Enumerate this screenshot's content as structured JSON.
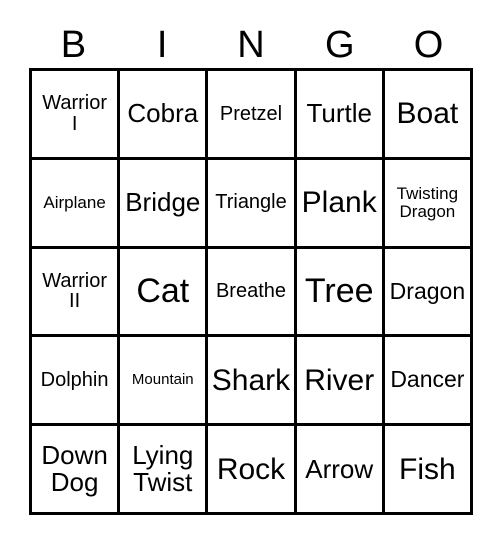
{
  "card": {
    "title_letters": [
      "B",
      "I",
      "N",
      "G",
      "O"
    ],
    "columns": [
      "B",
      "I",
      "N",
      "G",
      "O"
    ],
    "rows": [
      [
        {
          "label": "Warrior\nI",
          "size": "md"
        },
        {
          "label": "Cobra",
          "size": "xl"
        },
        {
          "label": "Pretzel",
          "size": "md"
        },
        {
          "label": "Turtle",
          "size": "xl"
        },
        {
          "label": "Boat",
          "size": "2xl"
        }
      ],
      [
        {
          "label": "Airplane",
          "size": "sm"
        },
        {
          "label": "Bridge",
          "size": "xl"
        },
        {
          "label": "Triangle",
          "size": "md"
        },
        {
          "label": "Plank",
          "size": "2xl"
        },
        {
          "label": "Twisting\nDragon",
          "size": "sm"
        }
      ],
      [
        {
          "label": "Warrior\nII",
          "size": "md"
        },
        {
          "label": "Cat",
          "size": "3xl"
        },
        {
          "label": "Breathe",
          "size": "md"
        },
        {
          "label": "Tree",
          "size": "3xl"
        },
        {
          "label": "Dragon",
          "size": "lg"
        }
      ],
      [
        {
          "label": "Dolphin",
          "size": "md"
        },
        {
          "label": "Mountain",
          "size": "xs"
        },
        {
          "label": "Shark",
          "size": "2xl"
        },
        {
          "label": "River",
          "size": "2xl"
        },
        {
          "label": "Dancer",
          "size": "lg"
        }
      ],
      [
        {
          "label": "Down\nDog",
          "size": "xl"
        },
        {
          "label": "Lying\nTwist",
          "size": "xl"
        },
        {
          "label": "Rock",
          "size": "2xl"
        },
        {
          "label": "Arrow",
          "size": "xl"
        },
        {
          "label": "Fish",
          "size": "2xl"
        }
      ]
    ]
  },
  "colors": {
    "border": "#000000",
    "background": "#ffffff",
    "text": "#000000"
  }
}
